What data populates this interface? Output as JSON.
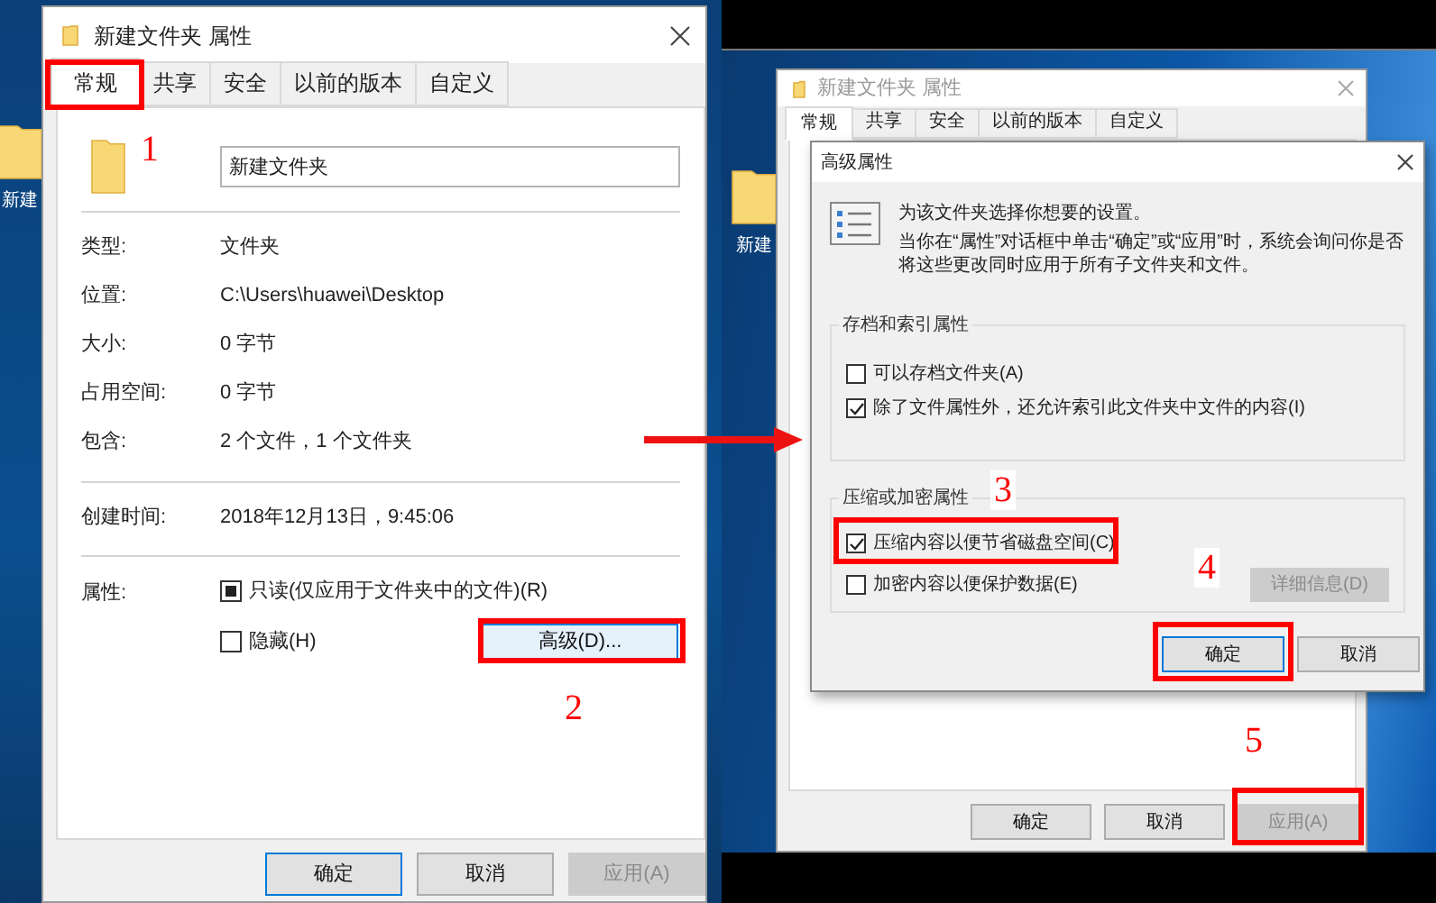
{
  "left": {
    "desktop_icon_label": "新建",
    "dialog": {
      "title": "新建文件夹 属性",
      "tabs": [
        {
          "label": "常规",
          "selected": true
        },
        {
          "label": "共享",
          "selected": false
        },
        {
          "label": "安全",
          "selected": false
        },
        {
          "label": "以前的版本",
          "selected": false
        },
        {
          "label": "自定义",
          "selected": false
        }
      ],
      "name": "新建文件夹",
      "info_rows": [
        {
          "label": "类型:",
          "value": "文件夹"
        },
        {
          "label": "位置:",
          "value": "C:\\Users\\huawei\\Desktop"
        },
        {
          "label": "大小:",
          "value": "0 字节"
        },
        {
          "label": "占用空间:",
          "value": "0 字节"
        },
        {
          "label": "包含:",
          "value": "2 个文件，1 个文件夹"
        }
      ],
      "created": {
        "label": "创建时间:",
        "value": "2018年12月13日，9:45:06"
      },
      "attributes_label": "属性:",
      "attributes": [
        {
          "label": "只读(仅应用于文件夹中的文件)(R)",
          "checked": false,
          "indeterminate": true
        },
        {
          "label": "隐藏(H)",
          "checked": false,
          "indeterminate": false
        }
      ],
      "advanced_button": "高级(D)...",
      "buttons": [
        {
          "label": "确定",
          "default": true,
          "disabled": false
        },
        {
          "label": "取消",
          "default": false,
          "disabled": false
        },
        {
          "label": "应用(A)",
          "default": false,
          "disabled": true
        }
      ]
    }
  },
  "right": {
    "desktop_icon_label": "新建",
    "back_dialog": {
      "title": "新建文件夹 属性",
      "tabs": [
        {
          "label": "常规",
          "selected": true
        },
        {
          "label": "共享",
          "selected": false
        },
        {
          "label": "安全",
          "selected": false
        },
        {
          "label": "以前的版本",
          "selected": false
        },
        {
          "label": "自定义",
          "selected": false
        }
      ],
      "buttons": [
        {
          "label": "确定",
          "default": false,
          "disabled": false
        },
        {
          "label": "取消",
          "default": false,
          "disabled": false
        },
        {
          "label": "应用(A)",
          "default": false,
          "disabled": true
        }
      ]
    },
    "advanced_dialog": {
      "title": "高级属性",
      "intro": "为该文件夹选择你想要的设置。",
      "note": "当你在“属性”对话框中单击“确定”或“应用”时，系统会询问你是否将这些更改同时应用于所有子文件夹和文件。",
      "groups": [
        {
          "title": "存档和索引属性",
          "options": [
            {
              "label": "可以存档文件夹(A)",
              "checked": false
            },
            {
              "label": "除了文件属性外，还允许索引此文件夹中文件的内容(I)",
              "checked": true
            }
          ]
        },
        {
          "title": "压缩或加密属性",
          "options": [
            {
              "label": "压缩内容以便节省磁盘空间(C)",
              "checked": true
            },
            {
              "label": "加密内容以便保护数据(E)",
              "checked": false
            }
          ],
          "details_button": {
            "label": "详细信息(D)",
            "disabled": true
          }
        }
      ],
      "buttons": [
        {
          "label": "确定",
          "default": true,
          "disabled": false
        },
        {
          "label": "取消",
          "default": false,
          "disabled": false
        }
      ]
    }
  },
  "annotations": [
    {
      "number": "1"
    },
    {
      "number": "2"
    },
    {
      "number": "3"
    },
    {
      "number": "4"
    },
    {
      "number": "5"
    }
  ]
}
